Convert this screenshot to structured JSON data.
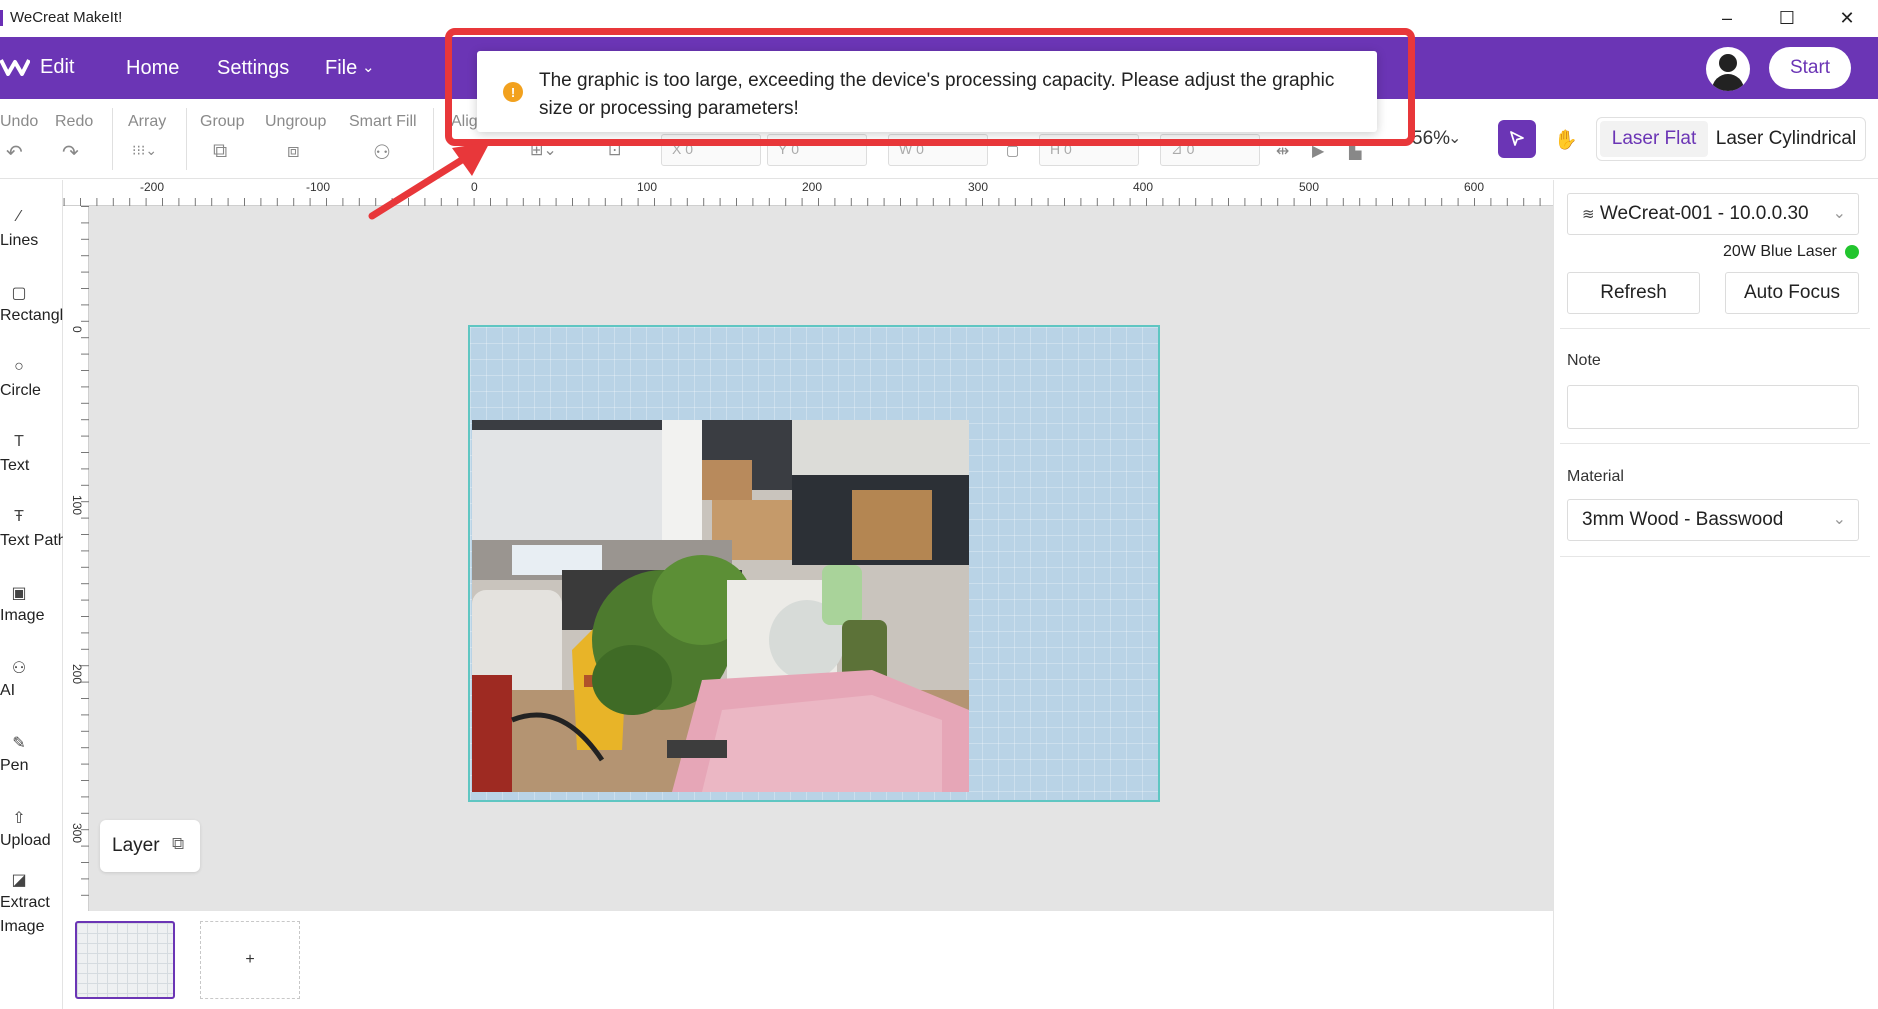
{
  "window": {
    "title": "WeCreat MakeIt!",
    "controls": {
      "minimize": "–",
      "maximize": "☐",
      "close": "✕"
    }
  },
  "header": {
    "app_label": "Edit",
    "nav": [
      "Home",
      "Settings",
      "File"
    ],
    "start_label": "Start"
  },
  "toolbar": {
    "labels": {
      "undo": "Undo",
      "redo": "Redo",
      "array": "Array",
      "group": "Group",
      "ungroup": "Ungroup",
      "smart_fill": "Smart Fill",
      "align": "Align"
    },
    "fields": {
      "x_label": "X",
      "x_value": "0",
      "y_label": "Y",
      "y_value": "0",
      "w_label": "W",
      "w_value": "0",
      "h_label": "H",
      "h_value": "0",
      "rotate_value": "0"
    },
    "zoom": "56%",
    "modes": [
      "Laser Flat",
      "Laser Cylindrical"
    ],
    "active_mode": "Laser Flat"
  },
  "sidebar": {
    "tools": [
      {
        "label": "Lines",
        "icon": "line-icon"
      },
      {
        "label": "Rectangle",
        "icon": "rectangle-icon"
      },
      {
        "label": "Circle",
        "icon": "circle-icon"
      },
      {
        "label": "Text",
        "icon": "text-icon"
      },
      {
        "label": "Text Path",
        "icon": "text-path-icon"
      },
      {
        "label": "Image",
        "icon": "image-icon"
      },
      {
        "label": "AI",
        "icon": "ai-icon"
      },
      {
        "label": "Pen",
        "icon": "pen-icon"
      },
      {
        "label": "Upload",
        "icon": "upload-icon"
      },
      {
        "label": "Extract",
        "label2": "Image",
        "icon": "extract-image-icon"
      }
    ]
  },
  "rulers": {
    "top": [
      "-200",
      "-100",
      "0",
      "100",
      "200",
      "300",
      "400",
      "500",
      "600"
    ],
    "left": [
      "0",
      "100",
      "200",
      "300"
    ]
  },
  "canvas": {
    "layer_label": "Layer",
    "add_page": "+"
  },
  "right_panel": {
    "device": "WeCreat-001 - 10.0.0.30",
    "laser_type": "20W Blue Laser",
    "status_color": "#22c52e",
    "refresh_label": "Refresh",
    "autofocus_label": "Auto Focus",
    "note_label": "Note",
    "note_value": "",
    "material_label": "Material",
    "material_value": "3mm Wood - Basswood"
  },
  "toast": {
    "message": "The graphic is too large, exceeding the device's processing capacity. Please adjust the graphic size or processing parameters!",
    "icon": "warning-icon",
    "icon_color": "#f2a11e"
  },
  "colors": {
    "brand": "#6b35b5",
    "annotation": "#e8373a",
    "workarea_border": "#5fc6c2"
  }
}
